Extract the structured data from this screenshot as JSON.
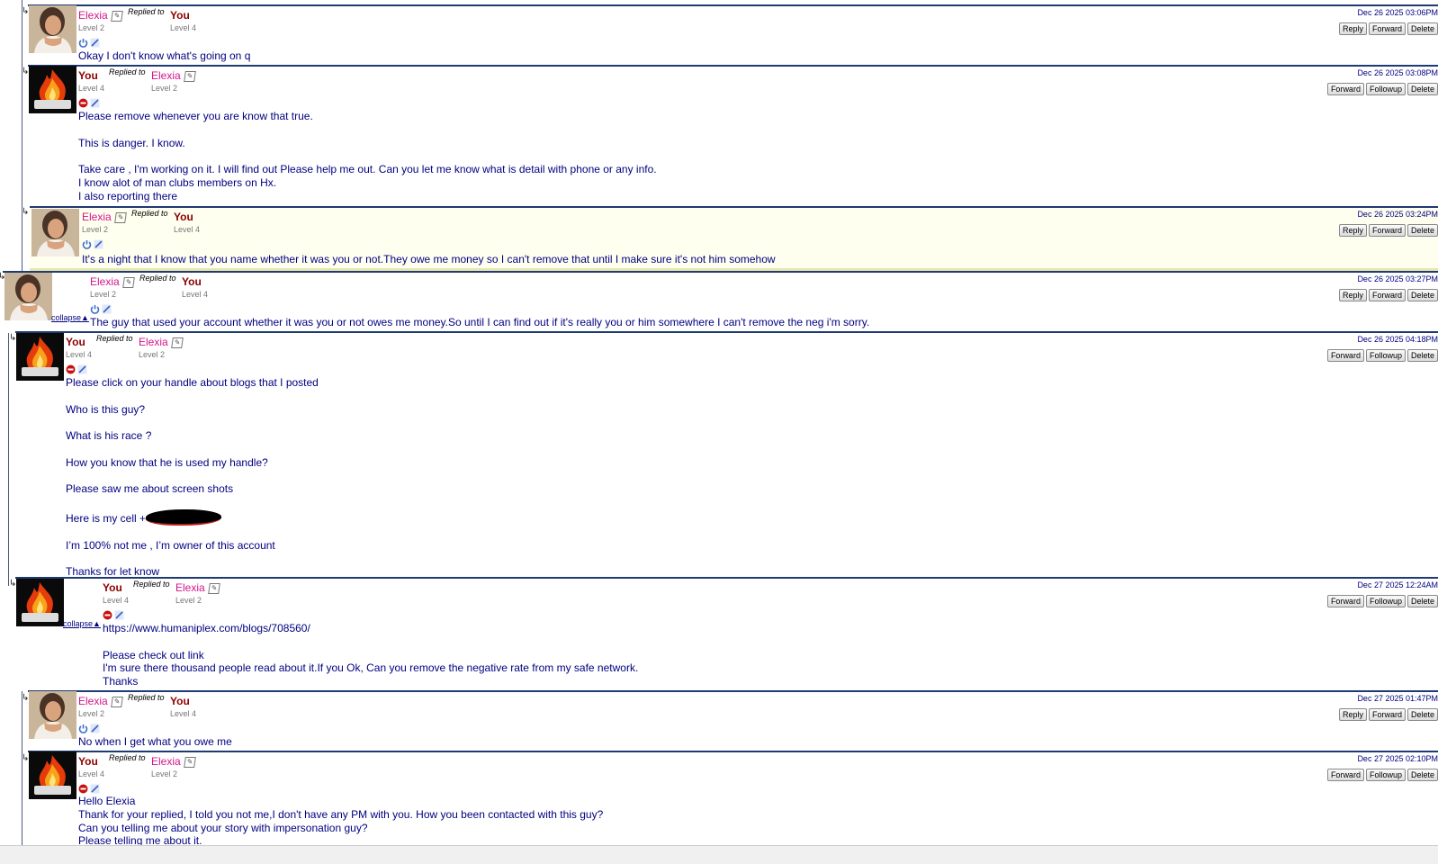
{
  "users": {
    "elexia": {
      "name": "Elexia",
      "level": "Level 2"
    },
    "you": {
      "name": "You",
      "level": "Level 4"
    }
  },
  "ui": {
    "replied_to": "Replied to",
    "collapse": "collapse▲",
    "reply": "Reply",
    "forward": "Forward",
    "followup": "Followup",
    "delete": "Delete"
  },
  "messages": [
    {
      "date": "Dec 26 2025 03:06PM",
      "body": [
        "Okay I don't know what's going on q"
      ]
    },
    {
      "date": "Dec 26 2025 03:08PM",
      "body": [
        "Please remove whenever you are know that true.",
        "",
        "This is danger. I know.",
        "",
        "Take care , I'm working on it. I will find out Please help me out. Can you let me know what is detail with phone or any info.",
        "I know alot of man clubs members on Hx.",
        "I also reporting there"
      ]
    },
    {
      "date": "Dec 26 2025 03:24PM",
      "body": [
        "It's a night that I know that you name whether it was you or not.They owe me money so I can't remove that until I make sure it's not him somehow"
      ]
    },
    {
      "date": "Dec 26 2025 03:27PM",
      "body": [
        "The guy that used your account whether it was you or not owes me money.So until I can find out if it's really you or him somewhere I can't remove the neg i'm sorry."
      ]
    },
    {
      "date": "Dec 26 2025 04:18PM",
      "body": [
        "Please click on your handle about blogs that I posted",
        "",
        "Who is this guy?",
        "",
        "What is his race ?",
        "",
        "How you know that he is used my handle?",
        "",
        "Please saw me about screen shots",
        "",
        "Here is my cell +",
        "",
        "I’m 100% not me , I’m owner of this account",
        "",
        "Thanks for let know"
      ]
    },
    {
      "date": "Dec 27 2025 12:24AM",
      "body": [
        "https://www.humaniplex.com/blogs/708560/",
        "",
        "Please check out link",
        "I'm sure there thousand people read about it.If you Ok, Can you remove the negative rate from my safe network.",
        "Thanks"
      ]
    },
    {
      "date": "Dec 27 2025 01:47PM",
      "body": [
        "No when I get what you owe me"
      ]
    },
    {
      "date": "Dec 27 2025 02:10PM",
      "body": [
        "Hello Elexia",
        "Thank for your replied, I told you not me,I don't have any PM with you. How you been contacted with this guy?",
        "Can you telling me about your story with impersonation guy?",
        "Please telling me about it."
      ]
    }
  ]
}
